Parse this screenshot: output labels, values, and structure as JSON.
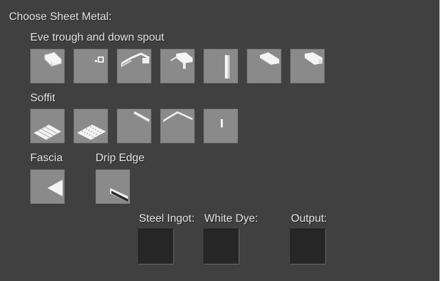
{
  "title": "Choose Sheet Metal:",
  "sections": {
    "eve": {
      "label": "Eve trough and down spout"
    },
    "soffit": {
      "label": "Soffit"
    },
    "fascia": {
      "label": "Fascia"
    },
    "drip": {
      "label": "Drip Edge"
    }
  },
  "slots": {
    "steel": {
      "label": "Steel Ingot:"
    },
    "dye": {
      "label": "White Dye:"
    },
    "output": {
      "label": "Output:"
    }
  },
  "icons": {
    "eve": [
      "gutter-straight-icon",
      "gutter-end-cap-icon",
      "gutter-corner-icon",
      "gutter-outlet-icon",
      "downspout-icon",
      "gutter-straight-alt-icon",
      "gutter-end-icon"
    ],
    "soffit": [
      "soffit-panel-flat-icon",
      "soffit-panel-vented-icon",
      "soffit-strip-icon",
      "soffit-corner-icon",
      "soffit-trim-icon"
    ],
    "fascia": [
      "fascia-icon"
    ],
    "drip": [
      "drip-edge-icon"
    ]
  },
  "colors": {
    "panel": "#404040",
    "button": "#8a8a8a",
    "slot": "#262626",
    "text": "#e6e6e6"
  }
}
